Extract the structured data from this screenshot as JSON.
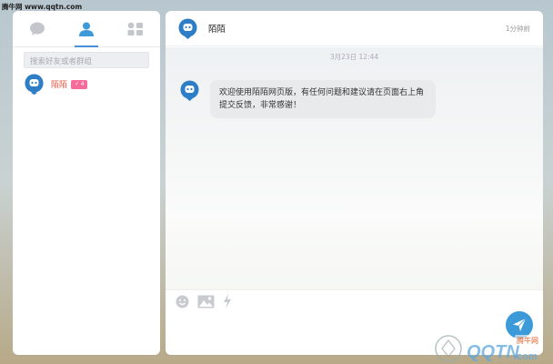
{
  "watermark": {
    "top_text": "腾牛网 www.qqtn.com",
    "logo_text": "QQTN",
    "logo_domain": ".com",
    "logo_badge": "腾牛网"
  },
  "sidebar": {
    "tabs": [
      {
        "name": "chat",
        "icon": "chat-bubble-icon"
      },
      {
        "name": "contacts",
        "icon": "person-icon",
        "active": true
      },
      {
        "name": "groups",
        "icon": "apps-grid-icon"
      }
    ],
    "search_placeholder": "搜索好友或者群组",
    "contacts": [
      {
        "name": "陌陌",
        "badge": "♂ 4"
      }
    ]
  },
  "chat": {
    "title": "陌陌",
    "time": "1分钟前",
    "date": "3月23日 12:44",
    "messages": [
      {
        "text": "欢迎使用陌陌网页版，有任何问题和建议请在页面右上角提交反馈，非常感谢！"
      }
    ]
  },
  "composer": {
    "tools": [
      "emoji-icon",
      "image-icon",
      "lightning-icon"
    ],
    "send": "send-icon"
  },
  "colors": {
    "accent": "#3d9ad9",
    "name_red": "#e4533e",
    "badge_pink": "#f56c9a"
  }
}
